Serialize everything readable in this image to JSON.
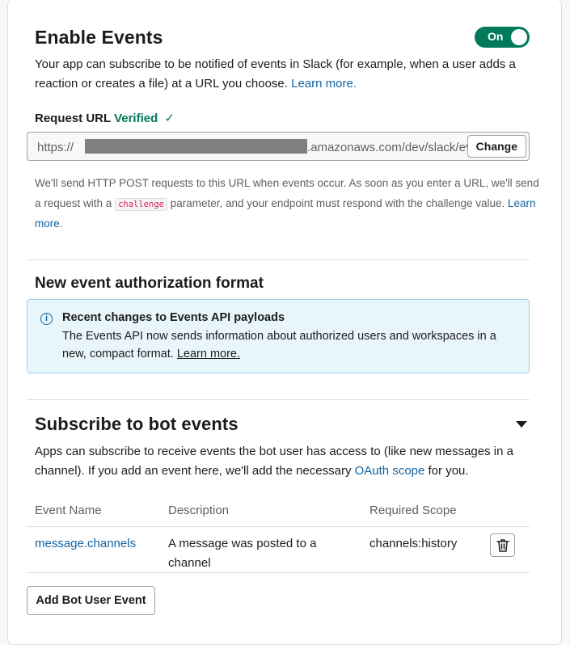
{
  "enable_events": {
    "title": "Enable Events",
    "toggle_label": "On",
    "description": "Your app can subscribe to be notified of events in Slack (for example, when a user adds a reaction or creates a file) at a URL you choose.",
    "learn_more": "Learn more."
  },
  "request_url": {
    "label": "Request URL",
    "status": "Verified",
    "status_mark": "✓",
    "prefix": "https://",
    "suffix": ".amazonaws.com/dev/slack/ev",
    "change_button": "Change",
    "help_part1": "We'll send HTTP POST requests to this URL when events occur. As soon as you enter a URL, we'll send a request with a",
    "help_code": "challenge",
    "help_part2": "parameter, and your endpoint must respond with the challenge value.",
    "learn_more": "Learn more."
  },
  "auth_format": {
    "title": "New event authorization format",
    "info_title": "Recent changes to Events API payloads",
    "info_text": "The Events API now sends information about authorized users and workspaces in a new, compact format.",
    "info_link": "Learn more."
  },
  "bot_events": {
    "title": "Subscribe to bot events",
    "description_part1": "Apps can subscribe to receive events the bot user has access to (like new messages in a channel). If you add an event here, we'll add the necessary",
    "oauth_link": "OAuth scope",
    "description_part2": "for you.",
    "columns": [
      "Event Name",
      "Description",
      "Required Scope"
    ],
    "rows": [
      {
        "event": "message.channels",
        "description": "A message was posted to a channel",
        "scope": "channels:history"
      }
    ],
    "add_button": "Add Bot User Event"
  }
}
